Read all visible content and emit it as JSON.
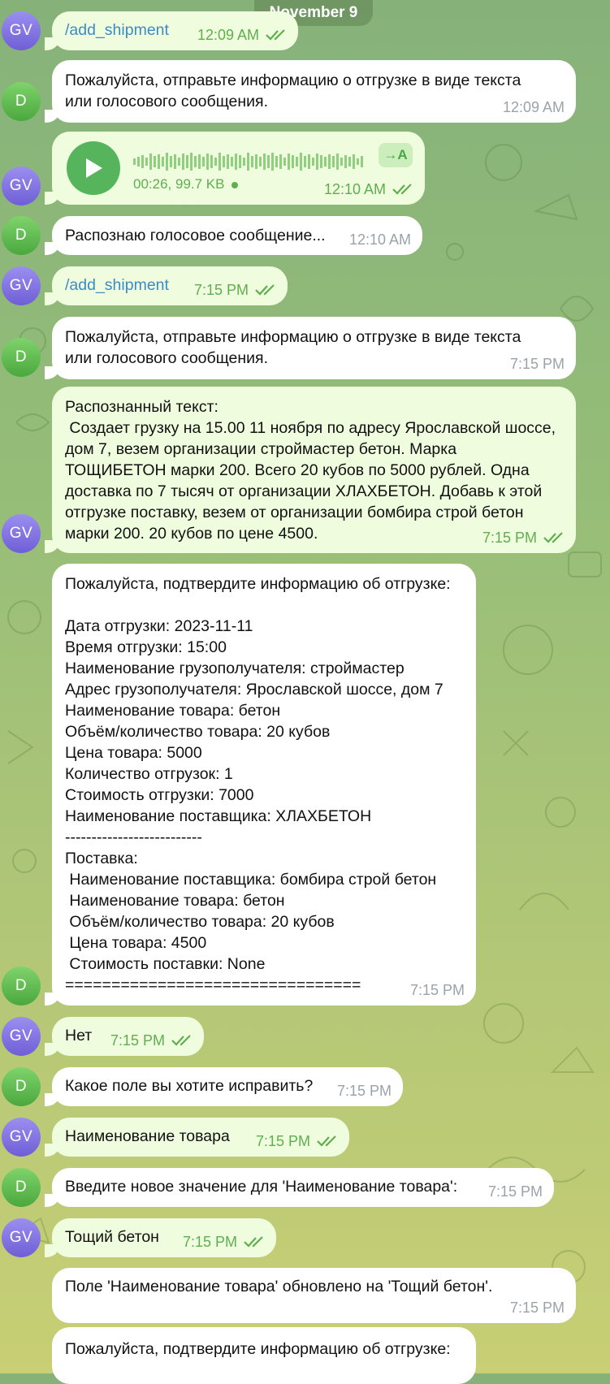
{
  "date_label": "November 9",
  "voice": {
    "duration_size": "00:26, 99.7 KB",
    "transcribe_label": "→A"
  },
  "messages": [
    {
      "sender": "GV",
      "text": "/add_shipment",
      "time": "12:09 AM"
    },
    {
      "sender": "D",
      "text": "Пожалуйста, отправьте информацию о отгрузке в виде текста\nили голосового сообщения.",
      "time": "12:09 AM"
    },
    {
      "sender": "GV",
      "text": "",
      "time": "12:10 AM"
    },
    {
      "sender": "D",
      "text": "Распознаю голосовое сообщение...",
      "time": "12:10 AM"
    },
    {
      "sender": "GV",
      "text": "/add_shipment",
      "time": "7:15 PM"
    },
    {
      "sender": "D",
      "text": "Пожалуйста, отправьте информацию о отгрузке в виде текста\nили голосового сообщения.",
      "time": "7:15 PM"
    },
    {
      "sender": "GV",
      "text": "Распознанный текст:\n Создает грузку на 15.00 11 ноября по адресу Ярославской шоссе,\nдом 7, везем организации строймастер бетон. Марка\nТОЩИБЕТОН марки 200. Всего 20 кубов по 5000 рублей. Одна\nдоставка по 7 тысяч от организации ХЛАХБЕТОН. Добавь к этой\nотгрузке поставку, везем от организации бомбира строй бетон\nмарки 200. 20 кубов по цене 4500.",
      "time": "7:15 PM"
    },
    {
      "sender": "D",
      "text": "Пожалуйста, подтвердите информацию об отгрузке:\n\nДата отгрузки: 2023-11-11\nВремя отгрузки: 15:00\nНаименование грузополучателя: строймастер\nАдрес грузополучателя: Ярославской шоссе, дом 7\nНаименование товара: бетон\nОбъём/количество товара: 20 кубов\nЦена товара: 5000\nКоличество отгрузок: 1\nСтоимость отгрузки: 7000\nНаименование поставщика: ХЛАХБЕТОН\n--------------------------\nПоставка:\n Наименование поставщика: бомбира строй бетон\n Наименование товара: бетон\n Объём/количество товара: 20 кубов\n Цена товара: 4500\n Стоимость поставки: None\n================================",
      "time": "7:15 PM"
    },
    {
      "sender": "GV",
      "text": "Нет",
      "time": "7:15 PM"
    },
    {
      "sender": "D",
      "text": "Какое поле вы хотите исправить?",
      "time": "7:15 PM"
    },
    {
      "sender": "GV",
      "text": "Наименование товара",
      "time": "7:15 PM"
    },
    {
      "sender": "D",
      "text": "Введите новое значение для 'Наименование товара':",
      "time": "7:15 PM"
    },
    {
      "sender": "GV",
      "text": "Тощий бетон",
      "time": "7:15 PM"
    },
    {
      "sender": "D",
      "text": "Поле 'Наименование товара' обновлено на 'Тощий бетон'.",
      "time": "7:15 PM"
    },
    {
      "sender": "D",
      "text": "Пожалуйста, подтвердите информацию об отгрузке:",
      "time": ""
    }
  ],
  "colors": {
    "outgoing_bubble": "#effdde",
    "incoming_bubble": "#ffffff",
    "outgoing_time": "#5fae4f",
    "incoming_time": "#9aa3a9",
    "link": "#3a8bc7"
  }
}
